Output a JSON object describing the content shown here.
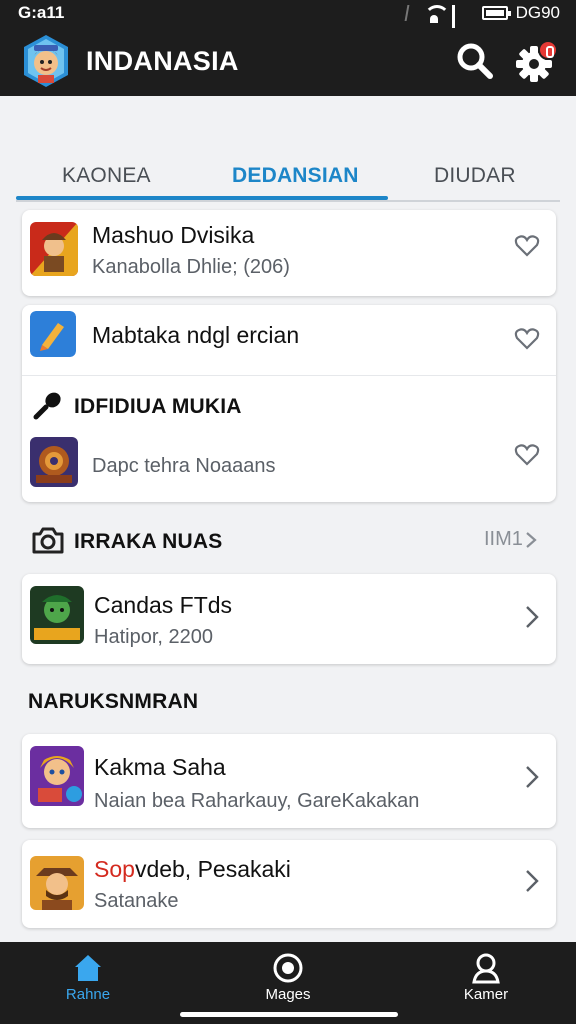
{
  "status_bar": {
    "time": "G:a11",
    "right_text": "DG90"
  },
  "app_bar": {
    "title": "INDANASIA"
  },
  "tabs": [
    {
      "label": "KAONEA",
      "active": false
    },
    {
      "label": "DEDANSIAN",
      "active": true
    },
    {
      "label": "DIUDAR",
      "active": false
    }
  ],
  "rows": {
    "row1": {
      "title": "Mashuo Dvisika",
      "subtitle": "Kanabolla Dhlie; (206)"
    },
    "row2": {
      "title": "Mabtaka ndgl ercian"
    },
    "section_inline": {
      "title": "IDFIDIUA MUKIA"
    },
    "row3": {
      "subtitle": "Dapc tehra Noaaans"
    }
  },
  "section2": {
    "title": "IRRAKA NUAS",
    "see_all": "IIM1"
  },
  "row4": {
    "title": "Candas FTds",
    "subtitle": "Hatipor, 2200"
  },
  "section3": {
    "title": "NARUKSNMRAN"
  },
  "row5": {
    "title": "Kakma Saha",
    "subtitle": "Naian bea Raharkauy, GareKakakan"
  },
  "row6": {
    "title_red": "Sop",
    "title_rest": "vdeb, Pesakaki",
    "subtitle": "Satanake"
  },
  "bottom_nav": [
    {
      "label": "Rahne",
      "icon": "home-icon",
      "active": true
    },
    {
      "label": "Mages",
      "icon": "disc-icon",
      "active": false
    },
    {
      "label": "Kamer",
      "icon": "person-icon",
      "active": false
    }
  ],
  "colors": {
    "accent": "#1d86c8",
    "bar": "#1d1d1d",
    "badge": "#e53935"
  }
}
